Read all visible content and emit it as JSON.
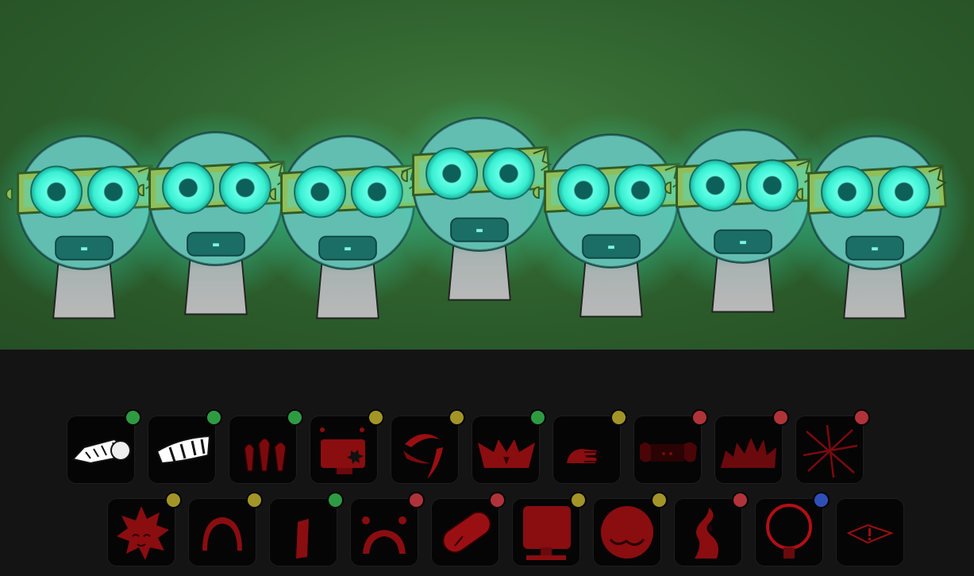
{
  "colors": {
    "background": "#2d5e2c",
    "tray": "#141414",
    "glow": "#35ffd9",
    "dot_green": "#2e9b43",
    "dot_yellow": "#a39427",
    "dot_red": "#b0333a",
    "dot_blue": "#2f4fb8"
  },
  "characters": {
    "count": 7,
    "variant": "glowing-goggles"
  },
  "icons": {
    "row1": [
      {
        "name": "bandaged-bone-icon",
        "indicator": "green",
        "locked": false
      },
      {
        "name": "bandage-mouth-icon",
        "indicator": "green",
        "locked": false
      },
      {
        "name": "triple-drips-icon",
        "indicator": "green",
        "locked": true
      },
      {
        "name": "broken-monitor-icon",
        "indicator": "yellow",
        "locked": true
      },
      {
        "name": "swirl-claws-icon",
        "indicator": "yellow",
        "locked": true
      },
      {
        "name": "spiky-crown-icon",
        "indicator": "green",
        "locked": true
      },
      {
        "name": "scratched-hand-icon",
        "indicator": "yellow",
        "locked": true
      },
      {
        "name": "dark-eyes-icon",
        "indicator": "red",
        "locked": true
      },
      {
        "name": "fire-shape-icon",
        "indicator": "red",
        "locked": true
      },
      {
        "name": "crossed-lines-icon",
        "indicator": "red",
        "locked": true
      }
    ],
    "row2": [
      {
        "name": "spiky-ball-icon",
        "indicator": "yellow",
        "locked": true
      },
      {
        "name": "arch-icon",
        "indicator": "yellow",
        "locked": true
      },
      {
        "name": "red-bar-icon",
        "indicator": "green",
        "locked": true
      },
      {
        "name": "sad-face-icon",
        "indicator": "red",
        "locked": true
      },
      {
        "name": "capsule-icon",
        "indicator": "red",
        "locked": true
      },
      {
        "name": "monitor-stand-icon",
        "indicator": "yellow",
        "locked": true
      },
      {
        "name": "round-mask-icon",
        "indicator": "yellow",
        "locked": true
      },
      {
        "name": "twisted-figure-icon",
        "indicator": "red",
        "locked": true
      },
      {
        "name": "ring-icon",
        "indicator": "blue",
        "locked": true
      },
      {
        "name": "warning-eye-icon",
        "indicator": "none",
        "locked": true
      }
    ]
  }
}
